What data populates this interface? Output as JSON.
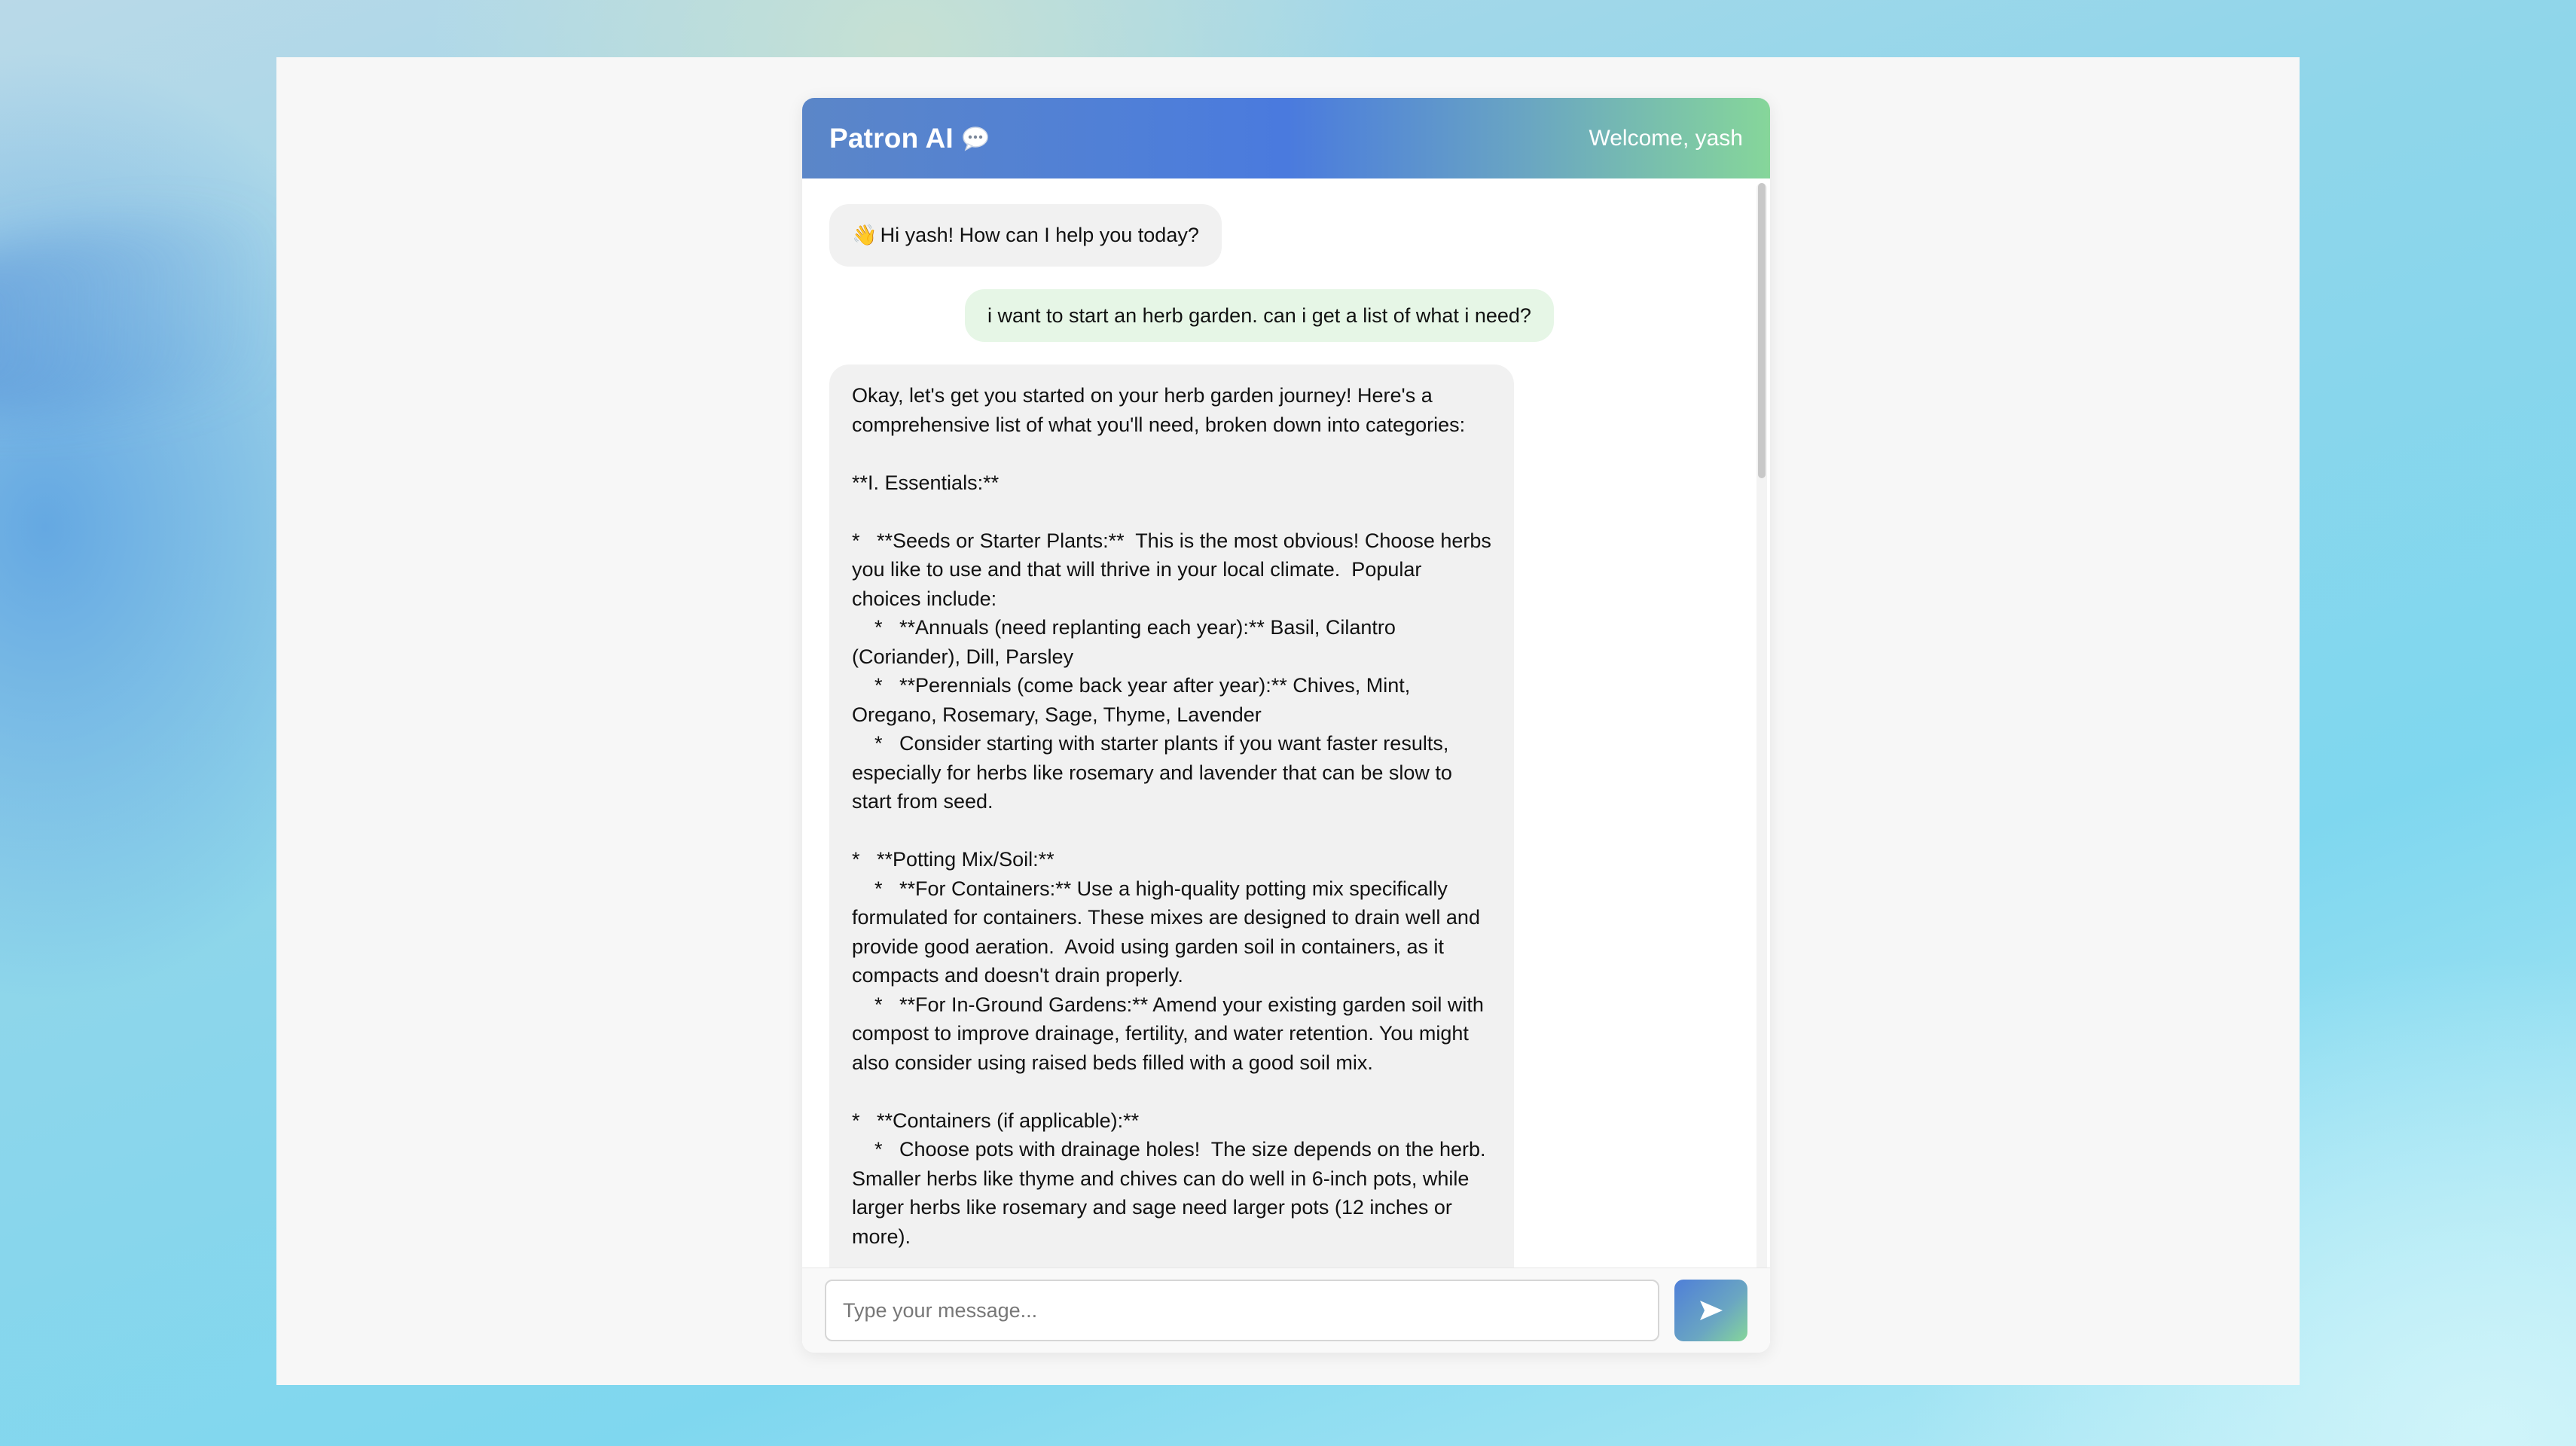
{
  "header": {
    "title": "Patron AI",
    "title_icon": "chat-bubble-icon",
    "welcome": "Welcome, yash"
  },
  "messages": [
    {
      "role": "assistant",
      "emoji": "👋",
      "text": "Hi yash! How can I help you today?"
    },
    {
      "role": "user",
      "text": "i want to start an herb garden. can i get a list of what i need?"
    },
    {
      "role": "assistant",
      "text": "Okay, let's get you started on your herb garden journey! Here's a comprehensive list of what you'll need, broken down into categories:\n\n**I. Essentials:**\n\n*   **Seeds or Starter Plants:**  This is the most obvious! Choose herbs you like to use and that will thrive in your local climate.  Popular choices include:\n    *   **Annuals (need replanting each year):** Basil, Cilantro (Coriander), Dill, Parsley\n    *   **Perennials (come back year after year):** Chives, Mint, Oregano, Rosemary, Sage, Thyme, Lavender\n    *   Consider starting with starter plants if you want faster results, especially for herbs like rosemary and lavender that can be slow to start from seed.\n\n*   **Potting Mix/Soil:**\n    *   **For Containers:** Use a high-quality potting mix specifically formulated for containers. These mixes are designed to drain well and provide good aeration.  Avoid using garden soil in containers, as it compacts and doesn't drain properly.\n    *   **For In-Ground Gardens:** Amend your existing garden soil with compost to improve drainage, fertility, and water retention. You might also consider using raised beds filled with a good soil mix.\n\n*   **Containers (if applicable):**\n    *   Choose pots with drainage holes!  The size depends on the herb.  Smaller herbs like thyme and chives can do well in 6-inch pots, while larger herbs like rosemary and sage need larger pots (12 inches or more)."
    }
  ],
  "composer": {
    "placeholder": "Type your message...",
    "send_icon": "send-arrow-icon"
  },
  "colors": {
    "header_gradient": [
      "#5b86c8",
      "#4a7ade",
      "#86d69a"
    ],
    "user_bubble": "#e6f6e6",
    "bot_bubble": "#f1f1f1"
  }
}
